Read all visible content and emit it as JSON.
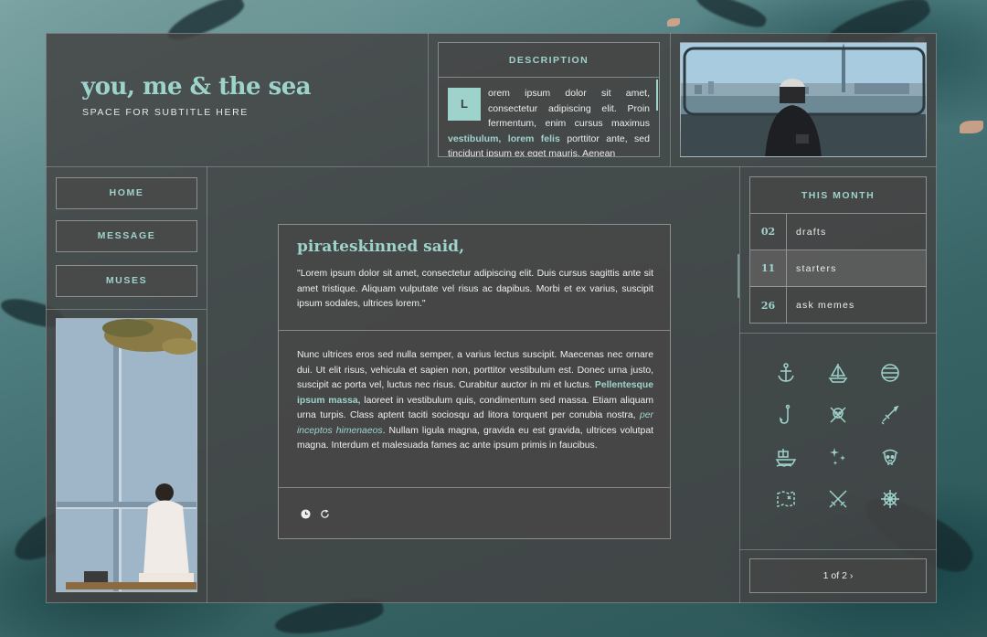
{
  "blog": {
    "title": "you, me & the sea",
    "subtitle": "SPACE FOR SUBTITLE HERE"
  },
  "description": {
    "heading": "DESCRIPTION",
    "dropcap": "L",
    "text_1": "orem ipsum dolor sit amet, consectetur adipiscing elit. Proin fermentum, enim cursus maximus ",
    "highlight": "vestibulum, lorem felis",
    "text_2": " porttitor ante, sed tincidunt ipsum ex eget mauris. Aenean"
  },
  "nav": {
    "items": [
      {
        "label": "HOME"
      },
      {
        "label": "MESSAGE"
      },
      {
        "label": "MUSES"
      }
    ]
  },
  "post": {
    "author": "pirateskinned said,",
    "quote": "\"Lorem ipsum dolor sit amet, consectetur adipiscing elit. Duis cursus sagittis ante sit amet tristique. Aliquam vulputate vel risus ac dapibus. Morbi et ex varius, suscipit ipsum sodales, ultrices lorem.\"",
    "body_1": "Nunc ultrices eros sed nulla semper, a varius lectus suscipit. Maecenas nec ornare dui. Ut elit risus, vehicula et sapien non, porttitor vestibulum est. Donec urna justo, suscipit ac porta vel, luctus nec risus. Curabitur auctor in mi et luctus. ",
    "body_bold": "Pellentesque ipsum massa,",
    "body_2": " laoreet in vestibulum quis, condimentum sed massa. Etiam aliquam urna turpis. Class aptent taciti sociosqu ad litora torquent per conubia nostra, ",
    "body_italic": "per inceptos himenaeos",
    "body_3": ". Nullam ligula magna, gravida eu est gravida, ultrices volutpat magna. Interdum et malesuada fames ac ante ipsum primis in faucibus.",
    "icons": [
      "clock-icon",
      "reblog-icon"
    ]
  },
  "this_month": {
    "heading": "THIS MONTH",
    "rows": [
      {
        "count": "02",
        "label": "drafts"
      },
      {
        "count": "11",
        "label": "starters"
      },
      {
        "count": "26",
        "label": "ask memes"
      }
    ]
  },
  "icon_grid": [
    "anchor-icon",
    "sailboat-icon",
    "globe-icon",
    "fishhook-icon",
    "skull-crossbones-icon",
    "sword-icon",
    "pirate-ship-icon",
    "sparkles-icon",
    "pirate-skull-icon",
    "treasure-map-icon",
    "crossed-swords-icon",
    "ship-wheel-icon"
  ],
  "pager": {
    "label": "1 of 2 ›"
  },
  "colors": {
    "accent": "#9ed3cc",
    "panel": "#444444",
    "text": "#ececec"
  }
}
